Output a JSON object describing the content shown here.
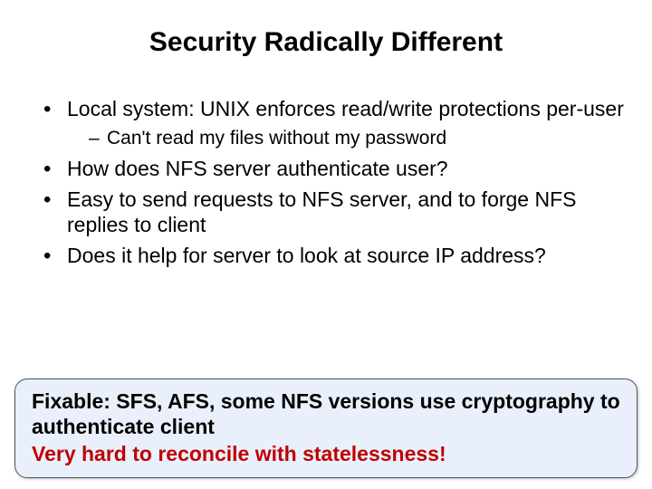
{
  "title": "Security Radically Different",
  "bullets": [
    {
      "text": "Local system: UNIX enforces read/write protections per-user",
      "sub": [
        "Can't read my files without my password"
      ]
    },
    {
      "text": "How does NFS server authenticate user?"
    },
    {
      "text": "Easy to send requests to NFS server, and to forge NFS replies to client"
    },
    {
      "text": "Does it help for server to look at source IP address?"
    }
  ],
  "callout": {
    "line1": "Fixable: SFS, AFS, some NFS versions use cryptography to authenticate client",
    "line2": "Very hard to reconcile with statelessness!"
  }
}
